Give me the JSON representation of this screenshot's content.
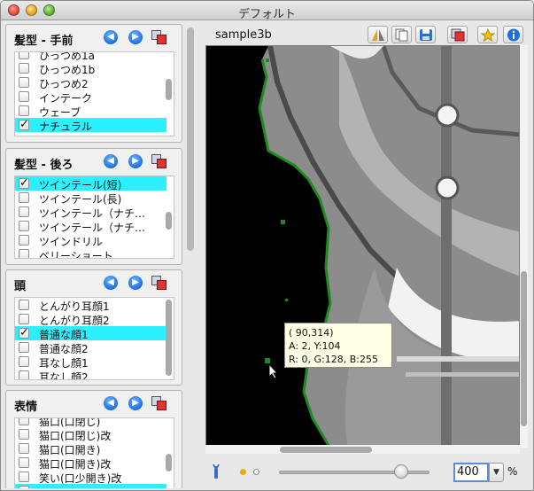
{
  "window": {
    "title": "デフォルト"
  },
  "panels": [
    {
      "title": "髪型 - 手前",
      "items": [
        {
          "label": "ひっつめ1a",
          "checked": false,
          "selected": false
        },
        {
          "label": "ひっつめ1b",
          "checked": false,
          "selected": false
        },
        {
          "label": "ひっつめ2",
          "checked": false,
          "selected": false
        },
        {
          "label": "インテーク",
          "checked": false,
          "selected": false
        },
        {
          "label": "ウェーブ",
          "checked": false,
          "selected": false
        },
        {
          "label": "ナチュラル",
          "checked": true,
          "selected": true
        }
      ]
    },
    {
      "title": "髪型 - 後ろ",
      "items": [
        {
          "label": "ツインテール(短)",
          "checked": true,
          "selected": true
        },
        {
          "label": "ツインテール(長)",
          "checked": false,
          "selected": false
        },
        {
          "label": "ツインテール（ナチ…",
          "checked": false,
          "selected": false
        },
        {
          "label": "ツインテール（ナチ…",
          "checked": false,
          "selected": false
        },
        {
          "label": "ツインドリル",
          "checked": false,
          "selected": false
        },
        {
          "label": "ベリーショート",
          "checked": false,
          "selected": false
        }
      ]
    },
    {
      "title": "頭",
      "items": [
        {
          "label": "とんがり耳顔1",
          "checked": false,
          "selected": false
        },
        {
          "label": "とんがり耳顔2",
          "checked": false,
          "selected": false
        },
        {
          "label": "普通な顔1",
          "checked": true,
          "selected": true
        },
        {
          "label": "普通な顔2",
          "checked": false,
          "selected": false
        },
        {
          "label": "耳なし顔1",
          "checked": false,
          "selected": false
        },
        {
          "label": "耳なし顔2",
          "checked": false,
          "selected": false
        }
      ]
    },
    {
      "title": "表情",
      "items": [
        {
          "label": "猫口(口閉じ)",
          "checked": false,
          "selected": false
        },
        {
          "label": "猫口(口閉じ)改",
          "checked": false,
          "selected": false
        },
        {
          "label": "猫口(口開き)",
          "checked": false,
          "selected": false
        },
        {
          "label": "猫口(口開き)改",
          "checked": false,
          "selected": false
        },
        {
          "label": "笑い(口少開き)改",
          "checked": false,
          "selected": false
        },
        {
          "label": "",
          "checked": false,
          "selected": true
        }
      ]
    }
  ],
  "document": {
    "name": "sample3b"
  },
  "toolbar": {
    "buttons": [
      "flip-icon",
      "copy-icon",
      "save-icon",
      "window-icon",
      "star-icon",
      "info-icon"
    ]
  },
  "pixel_info": {
    "coords": "( 90,314)",
    "alpha_line": "A:  2, Y:104",
    "rgb_line": "R:  0, G:128, B:255"
  },
  "zoom": {
    "value": "400",
    "unit": "%",
    "slider_level": 0.81
  },
  "colors": {
    "selection": "#2bf0ff",
    "accent": "#1d6fe0",
    "canvas_bg": "#000000",
    "tooltip_bg": "#ffffe6"
  }
}
